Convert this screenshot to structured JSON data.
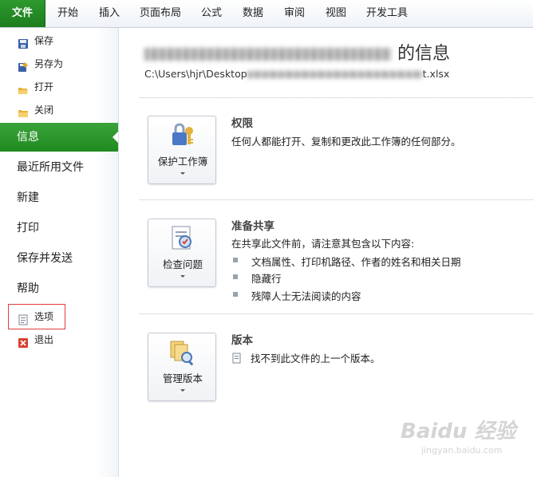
{
  "ribbon": {
    "tabs": [
      "文件",
      "开始",
      "插入",
      "页面布局",
      "公式",
      "数据",
      "审阅",
      "视图",
      "开发工具"
    ]
  },
  "backstage": {
    "small_top": [
      {
        "label": "保存",
        "icon": "save-icon"
      },
      {
        "label": "另存为",
        "icon": "save-as-icon"
      },
      {
        "label": "打开",
        "icon": "open-folder-icon"
      },
      {
        "label": "关闭",
        "icon": "close-folder-icon"
      }
    ],
    "big_items": [
      "信息",
      "最近所用文件",
      "新建",
      "打印",
      "保存并发送",
      "帮助"
    ],
    "active_item": "信息",
    "small_bottom": [
      {
        "label": "选项",
        "icon": "options-icon"
      },
      {
        "label": "退出",
        "icon": "exit-icon"
      }
    ]
  },
  "info": {
    "title_suffix": "的信息",
    "path_prefix": "C:\\Users\\hjr\\Desktop",
    "path_suffix": "t.xlsx"
  },
  "sections": {
    "permissions": {
      "button_label": "保护工作簿",
      "title": "权限",
      "desc": "任何人都能打开、复制和更改此工作簿的任何部分。"
    },
    "prepare": {
      "button_label": "检查问题",
      "title": "准备共享",
      "desc": "在共享此文件前，请注意其包含以下内容:",
      "bullets": [
        "文档属性、打印机路径、作者的姓名和相关日期",
        "隐藏行",
        "残障人士无法阅读的内容"
      ]
    },
    "versions": {
      "button_label": "管理版本",
      "title": "版本",
      "desc": "找不到此文件的上一个版本。"
    }
  },
  "watermark": {
    "brand": "Baidu 经验",
    "url": "jingyan.baidu.com"
  },
  "colors": {
    "accent_green": "#2e9a2e",
    "highlight_red": "#e03c3c"
  }
}
